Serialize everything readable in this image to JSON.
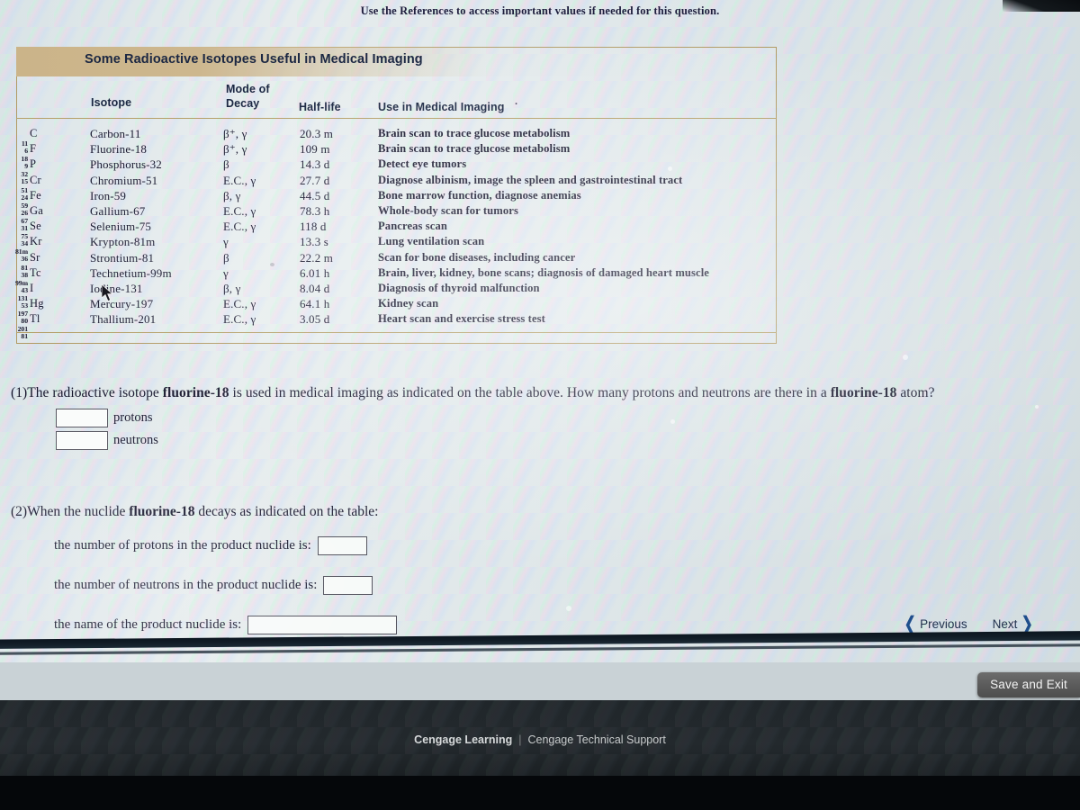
{
  "header": {
    "reference_note": "Use the References to access important values if needed for this question."
  },
  "figure": {
    "title": "Some Radioactive Isotopes Useful in Medical Imaging",
    "columns": {
      "isotope": "Isotope",
      "mode_of_decay_line1": "Mode of",
      "mode_of_decay_line2": "Decay",
      "half_life": "Half-life",
      "use": "Use in Medical Imaging"
    },
    "rows": [
      {
        "mass": "11",
        "atomic": "6",
        "symbol": "C",
        "name": "Carbon-11",
        "mode": "β⁺, γ",
        "half_life": "20.3 m",
        "use": "Brain scan to trace glucose metabolism"
      },
      {
        "mass": "18",
        "atomic": "9",
        "symbol": "F",
        "name": "Fluorine-18",
        "mode": "β⁺, γ",
        "half_life": "109 m",
        "use": "Brain scan to trace glucose metabolism"
      },
      {
        "mass": "32",
        "atomic": "15",
        "symbol": "P",
        "name": "Phosphorus-32",
        "mode": "β",
        "half_life": "14.3 d",
        "use": "Detect eye tumors"
      },
      {
        "mass": "51",
        "atomic": "24",
        "symbol": "Cr",
        "name": "Chromium-51",
        "mode": "E.C., γ",
        "half_life": "27.7 d",
        "use": "Diagnose albinism, image the spleen and gastrointestinal tract"
      },
      {
        "mass": "59",
        "atomic": "26",
        "symbol": "Fe",
        "name": "Iron-59",
        "mode": "β, γ",
        "half_life": "44.5 d",
        "use": "Bone marrow function, diagnose anemias"
      },
      {
        "mass": "67",
        "atomic": "31",
        "symbol": "Ga",
        "name": "Gallium-67",
        "mode": "E.C., γ",
        "half_life": "78.3 h",
        "use": "Whole-body scan for tumors"
      },
      {
        "mass": "75",
        "atomic": "34",
        "symbol": "Se",
        "name": "Selenium-75",
        "mode": "E.C., γ",
        "half_life": "118 d",
        "use": "Pancreas scan"
      },
      {
        "mass": "81m",
        "atomic": "36",
        "symbol": "Kr",
        "name": "Krypton-81m",
        "mode": "γ",
        "half_life": "13.3 s",
        "use": "Lung ventilation scan"
      },
      {
        "mass": "81",
        "atomic": "38",
        "symbol": "Sr",
        "name": "Strontium-81",
        "mode": "β",
        "half_life": "22.2 m",
        "use": "Scan for bone diseases, including cancer"
      },
      {
        "mass": "99m",
        "atomic": "43",
        "symbol": "Tc",
        "name": "Technetium-99m",
        "mode": "γ",
        "half_life": "6.01 h",
        "use": "Brain, liver, kidney, bone scans; diagnosis of damaged heart muscle"
      },
      {
        "mass": "131",
        "atomic": "53",
        "symbol": "I",
        "name": "Iodine-131",
        "mode": "β, γ",
        "half_life": "8.04 d",
        "use": "Diagnosis of thyroid malfunction"
      },
      {
        "mass": "197",
        "atomic": "80",
        "symbol": "Hg",
        "name": "Mercury-197",
        "mode": "E.C., γ",
        "half_life": "64.1 h",
        "use": "Kidney scan"
      },
      {
        "mass": "201",
        "atomic": "81",
        "symbol": "Tl",
        "name": "Thallium-201",
        "mode": "E.C., γ",
        "half_life": "3.05 d",
        "use": "Heart scan and exercise stress test"
      }
    ]
  },
  "question1": {
    "number": "(1)",
    "text_part1": "The radioactive isotope ",
    "bold1": "fluorine-18",
    "text_part2": " is used in medical imaging as indicated on the table above. How many protons and neutrons are there in a ",
    "bold2": "fluorine-18",
    "text_part3": " atom?",
    "protons_value": "",
    "protons_label": "protons",
    "neutrons_value": "",
    "neutrons_label": "neutrons"
  },
  "question2": {
    "number": "(2)",
    "text_part1": "When the nuclide ",
    "bold1": "fluorine-18",
    "text_part2": " decays as indicated on the table:",
    "sub1_label": "the number of protons in the product nuclide is:",
    "sub1_value": "",
    "sub2_label": "the number of neutrons in the product nuclide is:",
    "sub2_value": "",
    "sub3_label": "the name of the product nuclide is:",
    "sub3_value": ""
  },
  "navigation": {
    "previous_label": "Previous",
    "previous_icon": "chevron-left-icon",
    "next_label": "Next",
    "next_icon": "chevron-right-icon",
    "save_and_exit_label": "Save and Exit"
  },
  "footer": {
    "brand": "Cengage Learning",
    "separator": "|",
    "support": "Cengage Technical Support"
  },
  "colors": {
    "page_background": "#dfe7e9",
    "figure_border": "#b19a63",
    "figure_title_band": "#cbb489",
    "heading_text": "#1b2742",
    "body_text": "#1a1a30",
    "nav_chevron": "#1f4e8c",
    "save_button": "#5a5a5a",
    "footer_band": "#20262a"
  }
}
